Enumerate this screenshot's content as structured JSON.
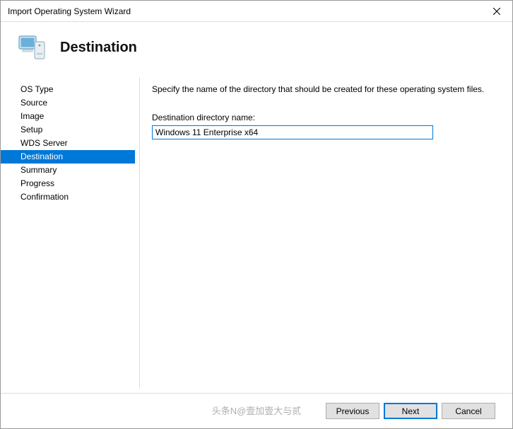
{
  "window": {
    "title": "Import Operating System Wizard"
  },
  "header": {
    "title": "Destination"
  },
  "sidebar": {
    "items": [
      {
        "label": "OS Type"
      },
      {
        "label": "Source"
      },
      {
        "label": "Image"
      },
      {
        "label": "Setup"
      },
      {
        "label": "WDS Server"
      },
      {
        "label": "Destination"
      },
      {
        "label": "Summary"
      },
      {
        "label": "Progress"
      },
      {
        "label": "Confirmation"
      }
    ],
    "selected_index": 5
  },
  "main": {
    "instruction": "Specify the name of the directory that should be created for these operating system files.",
    "field_label": "Destination directory name:",
    "field_value": "Windows 11 Enterprise x64"
  },
  "footer": {
    "previous": "Previous",
    "next": "Next",
    "cancel": "Cancel"
  },
  "watermark": "头条N@壹加壹大与贰"
}
